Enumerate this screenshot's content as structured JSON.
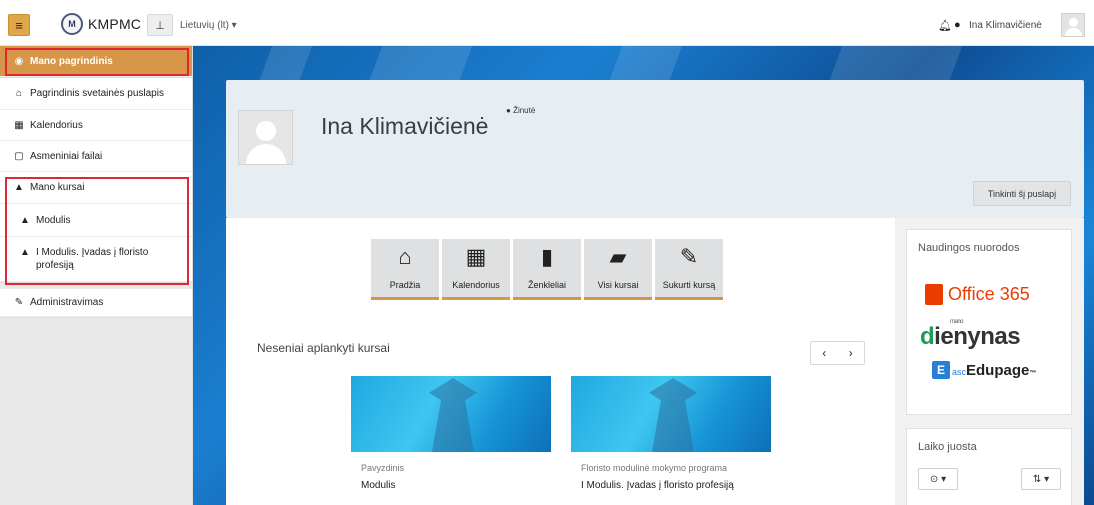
{
  "navbar": {
    "brand": "KMPMC",
    "language": "Lietuvių (lt) ▾",
    "username": "Ina Klimavičienė"
  },
  "sidebar": {
    "items": [
      {
        "label": "Mano pagrindinis",
        "icon": "dashboard-icon",
        "active": true
      },
      {
        "label": "Pagrindinis svetainės puslapis",
        "icon": "home-icon"
      },
      {
        "label": "Kalendorius",
        "icon": "calendar-icon"
      },
      {
        "label": "Asmeniniai failai",
        "icon": "file-icon"
      },
      {
        "label": "Mano kursai",
        "icon": "graduation-cap-icon"
      },
      {
        "label": "Modulis",
        "icon": "graduation-cap-icon"
      },
      {
        "label": "I Modulis. Įvadas į floristo profesiją",
        "icon": "graduation-cap-icon"
      },
      {
        "label": "Administravimas",
        "icon": "wrench-icon"
      }
    ]
  },
  "header": {
    "name": "Ina Klimavičienė",
    "message_label": "Žinutė",
    "reset_label": "Tinkinti šį puslapį"
  },
  "tiles": [
    {
      "label": "Pradžia",
      "icon": "home-icon"
    },
    {
      "label": "Kalendorius",
      "icon": "calendar-icon"
    },
    {
      "label": "Ženkleliai",
      "icon": "bookmark-icon"
    },
    {
      "label": "Visi kursai",
      "icon": "book-icon"
    },
    {
      "label": "Sukurti kursą",
      "icon": "edit-icon"
    }
  ],
  "recent": {
    "title": "Neseniai aplankyti kursai",
    "courses": [
      {
        "category": "Pavyzdinis",
        "name": "Modulis"
      },
      {
        "category": "Floristo modulinė mokymo programa",
        "name": "I Modulis. Įvadas į floristo profesiją"
      }
    ]
  },
  "links_block": {
    "title": "Naudingos nuorodos",
    "office": "Office 365",
    "dienynas_prefix": "d",
    "dienynas_rest": "ienynas",
    "dienynas_small": "mano",
    "edupage_asc": "asc",
    "edupage_name": "Edupage",
    "edupage_tm": "™"
  },
  "timeline_block": {
    "title": "Laiko juosta"
  },
  "colors": {
    "accent": "#d6974a",
    "highlight_red": "#e0262e",
    "office_red": "#eb3c00"
  }
}
